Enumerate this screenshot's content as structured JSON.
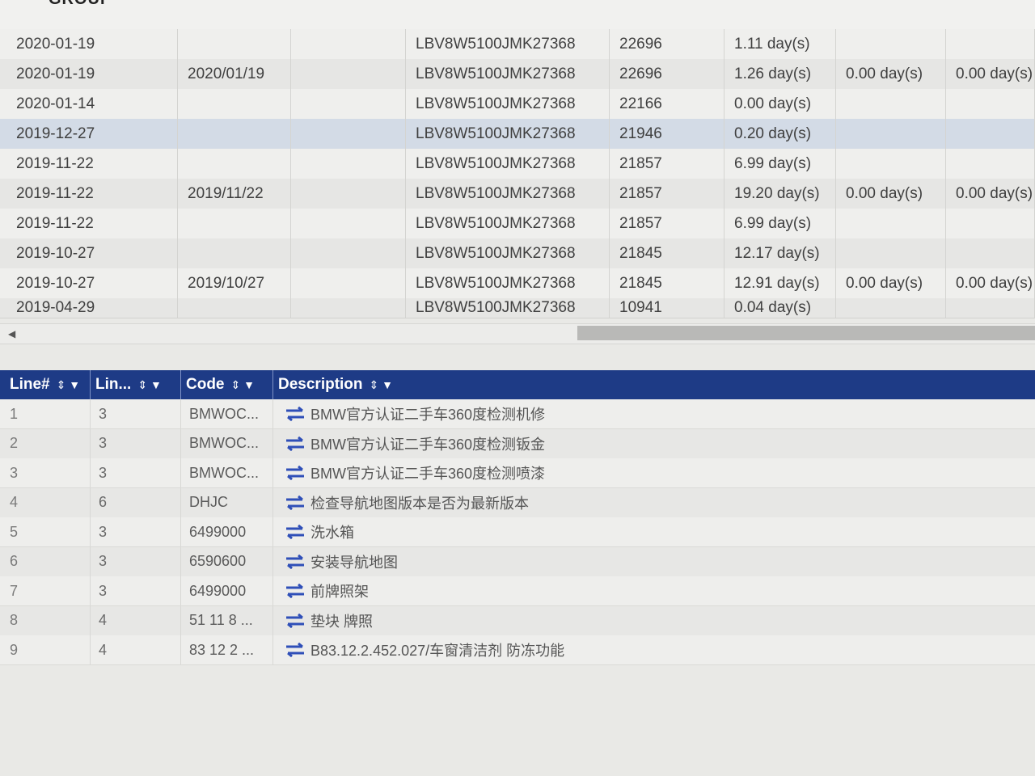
{
  "header": {
    "logo_fragment": "GROUP"
  },
  "history": {
    "rows": [
      {
        "date": "2020-01-19",
        "date2": "",
        "vin": "LBV8W5100JMK27368",
        "km": "22696",
        "d1": "1.11 day(s)",
        "d2": "",
        "d3": ""
      },
      {
        "date": "2020-01-19",
        "date2": "2020/01/19",
        "vin": "LBV8W5100JMK27368",
        "km": "22696",
        "d1": "1.26 day(s)",
        "d2": "0.00 day(s)",
        "d3": "0.00 day(s)"
      },
      {
        "date": "2020-01-14",
        "date2": "",
        "vin": "LBV8W5100JMK27368",
        "km": "22166",
        "d1": "0.00 day(s)",
        "d2": "",
        "d3": ""
      },
      {
        "date": "2019-12-27",
        "date2": "",
        "vin": "LBV8W5100JMK27368",
        "km": "21946",
        "d1": "0.20 day(s)",
        "d2": "",
        "d3": ""
      },
      {
        "date": "2019-11-22",
        "date2": "",
        "vin": "LBV8W5100JMK27368",
        "km": "21857",
        "d1": "6.99 day(s)",
        "d2": "",
        "d3": ""
      },
      {
        "date": "2019-11-22",
        "date2": "2019/11/22",
        "vin": "LBV8W5100JMK27368",
        "km": "21857",
        "d1": "19.20 day(s)",
        "d2": "0.00 day(s)",
        "d3": "0.00 day(s)"
      },
      {
        "date": "2019-11-22",
        "date2": "",
        "vin": "LBV8W5100JMK27368",
        "km": "21857",
        "d1": "6.99 day(s)",
        "d2": "",
        "d3": ""
      },
      {
        "date": "2019-10-27",
        "date2": "",
        "vin": "LBV8W5100JMK27368",
        "km": "21845",
        "d1": "12.17 day(s)",
        "d2": "",
        "d3": ""
      },
      {
        "date": "2019-10-27",
        "date2": "2019/10/27",
        "vin": "LBV8W5100JMK27368",
        "km": "21845",
        "d1": "12.91 day(s)",
        "d2": "0.00 day(s)",
        "d3": "0.00 day(s)"
      },
      {
        "date": "2019-04-29",
        "date2": "",
        "vin": "LBV8W5100JMK27368",
        "km": "10941",
        "d1": "0.04 day(s)",
        "d2": "",
        "d3": ""
      }
    ]
  },
  "lines": {
    "headers": {
      "line_no": "Line#",
      "lin": "Lin...",
      "code": "Code",
      "description": "Description"
    },
    "rows": [
      {
        "line": "1",
        "lin": "3",
        "code": "BMWOC...",
        "desc": "BMW官方认证二手车360度检测机修"
      },
      {
        "line": "2",
        "lin": "3",
        "code": "BMWOC...",
        "desc": "BMW官方认证二手车360度检测钣金"
      },
      {
        "line": "3",
        "lin": "3",
        "code": "BMWOC...",
        "desc": "BMW官方认证二手车360度检测喷漆"
      },
      {
        "line": "4",
        "lin": "6",
        "code": "DHJC",
        "desc": "检查导航地图版本是否为最新版本"
      },
      {
        "line": "5",
        "lin": "3",
        "code": "6499000",
        "desc": "洗水箱"
      },
      {
        "line": "6",
        "lin": "3",
        "code": "6590600",
        "desc": "安装导航地图"
      },
      {
        "line": "7",
        "lin": "3",
        "code": "6499000",
        "desc": "前牌照架"
      },
      {
        "line": "8",
        "lin": "4",
        "code": "51 11 8 ...",
        "desc": "垫块 牌照"
      },
      {
        "line": "9",
        "lin": "4",
        "code": "83 12 2 ...",
        "desc": "B83.12.2.452.027/车窗清洁剂 防冻功能"
      }
    ]
  },
  "colors": {
    "header_bg": "#1e3b86",
    "selected_row": "#d3dbe6",
    "swap_icon": "#2f4fb8"
  },
  "icons": {
    "sort": "sort-arrows-icon",
    "filter": "filter-icon",
    "row": "swap-arrows-icon",
    "scroll_left": "chevron-left-icon"
  }
}
